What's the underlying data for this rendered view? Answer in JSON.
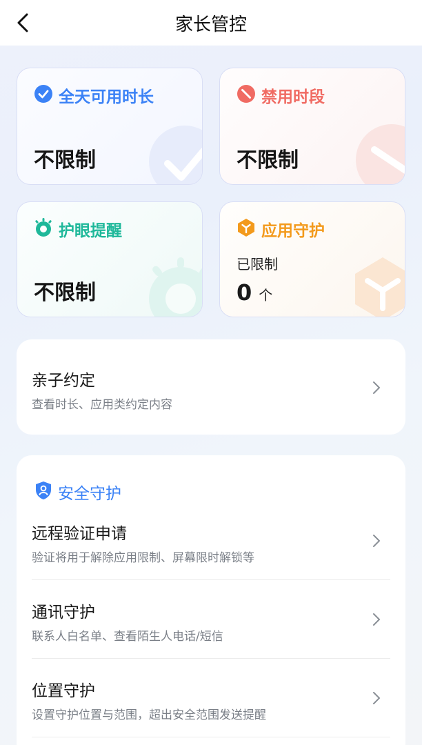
{
  "header": {
    "title": "家长管控",
    "back_icon": "back-arrow-icon"
  },
  "cards": {
    "daily_time": {
      "label": "全天可用时长",
      "value": "不限制",
      "icon": "check-circle-icon",
      "color": "#3b82f6"
    },
    "blocked_period": {
      "label": "禁用时段",
      "value": "不限制",
      "icon": "forbidden-icon",
      "color": "#f06b63"
    },
    "eye_reminder": {
      "label": "护眼提醒",
      "value": "不限制",
      "icon": "eye-icon",
      "color": "#1fb89a"
    },
    "app_guard": {
      "label": "应用守护",
      "sub": "已限制",
      "count": "0",
      "unit": "个",
      "icon": "app-guard-icon",
      "color": "#f39a1c"
    }
  },
  "agreement": {
    "title": "亲子约定",
    "subtitle": "查看时长、应用类约定内容"
  },
  "security": {
    "section_label": "安全守护",
    "items": [
      {
        "title": "远程验证申请",
        "subtitle": "验证将用于解除应用限制、屏幕限时解锁等"
      },
      {
        "title": "通讯守护",
        "subtitle": "联系人白名单、查看陌生人电话/短信"
      },
      {
        "title": "位置守护",
        "subtitle": "设置守护位置与范围，超出安全范围发送提醒"
      }
    ]
  }
}
